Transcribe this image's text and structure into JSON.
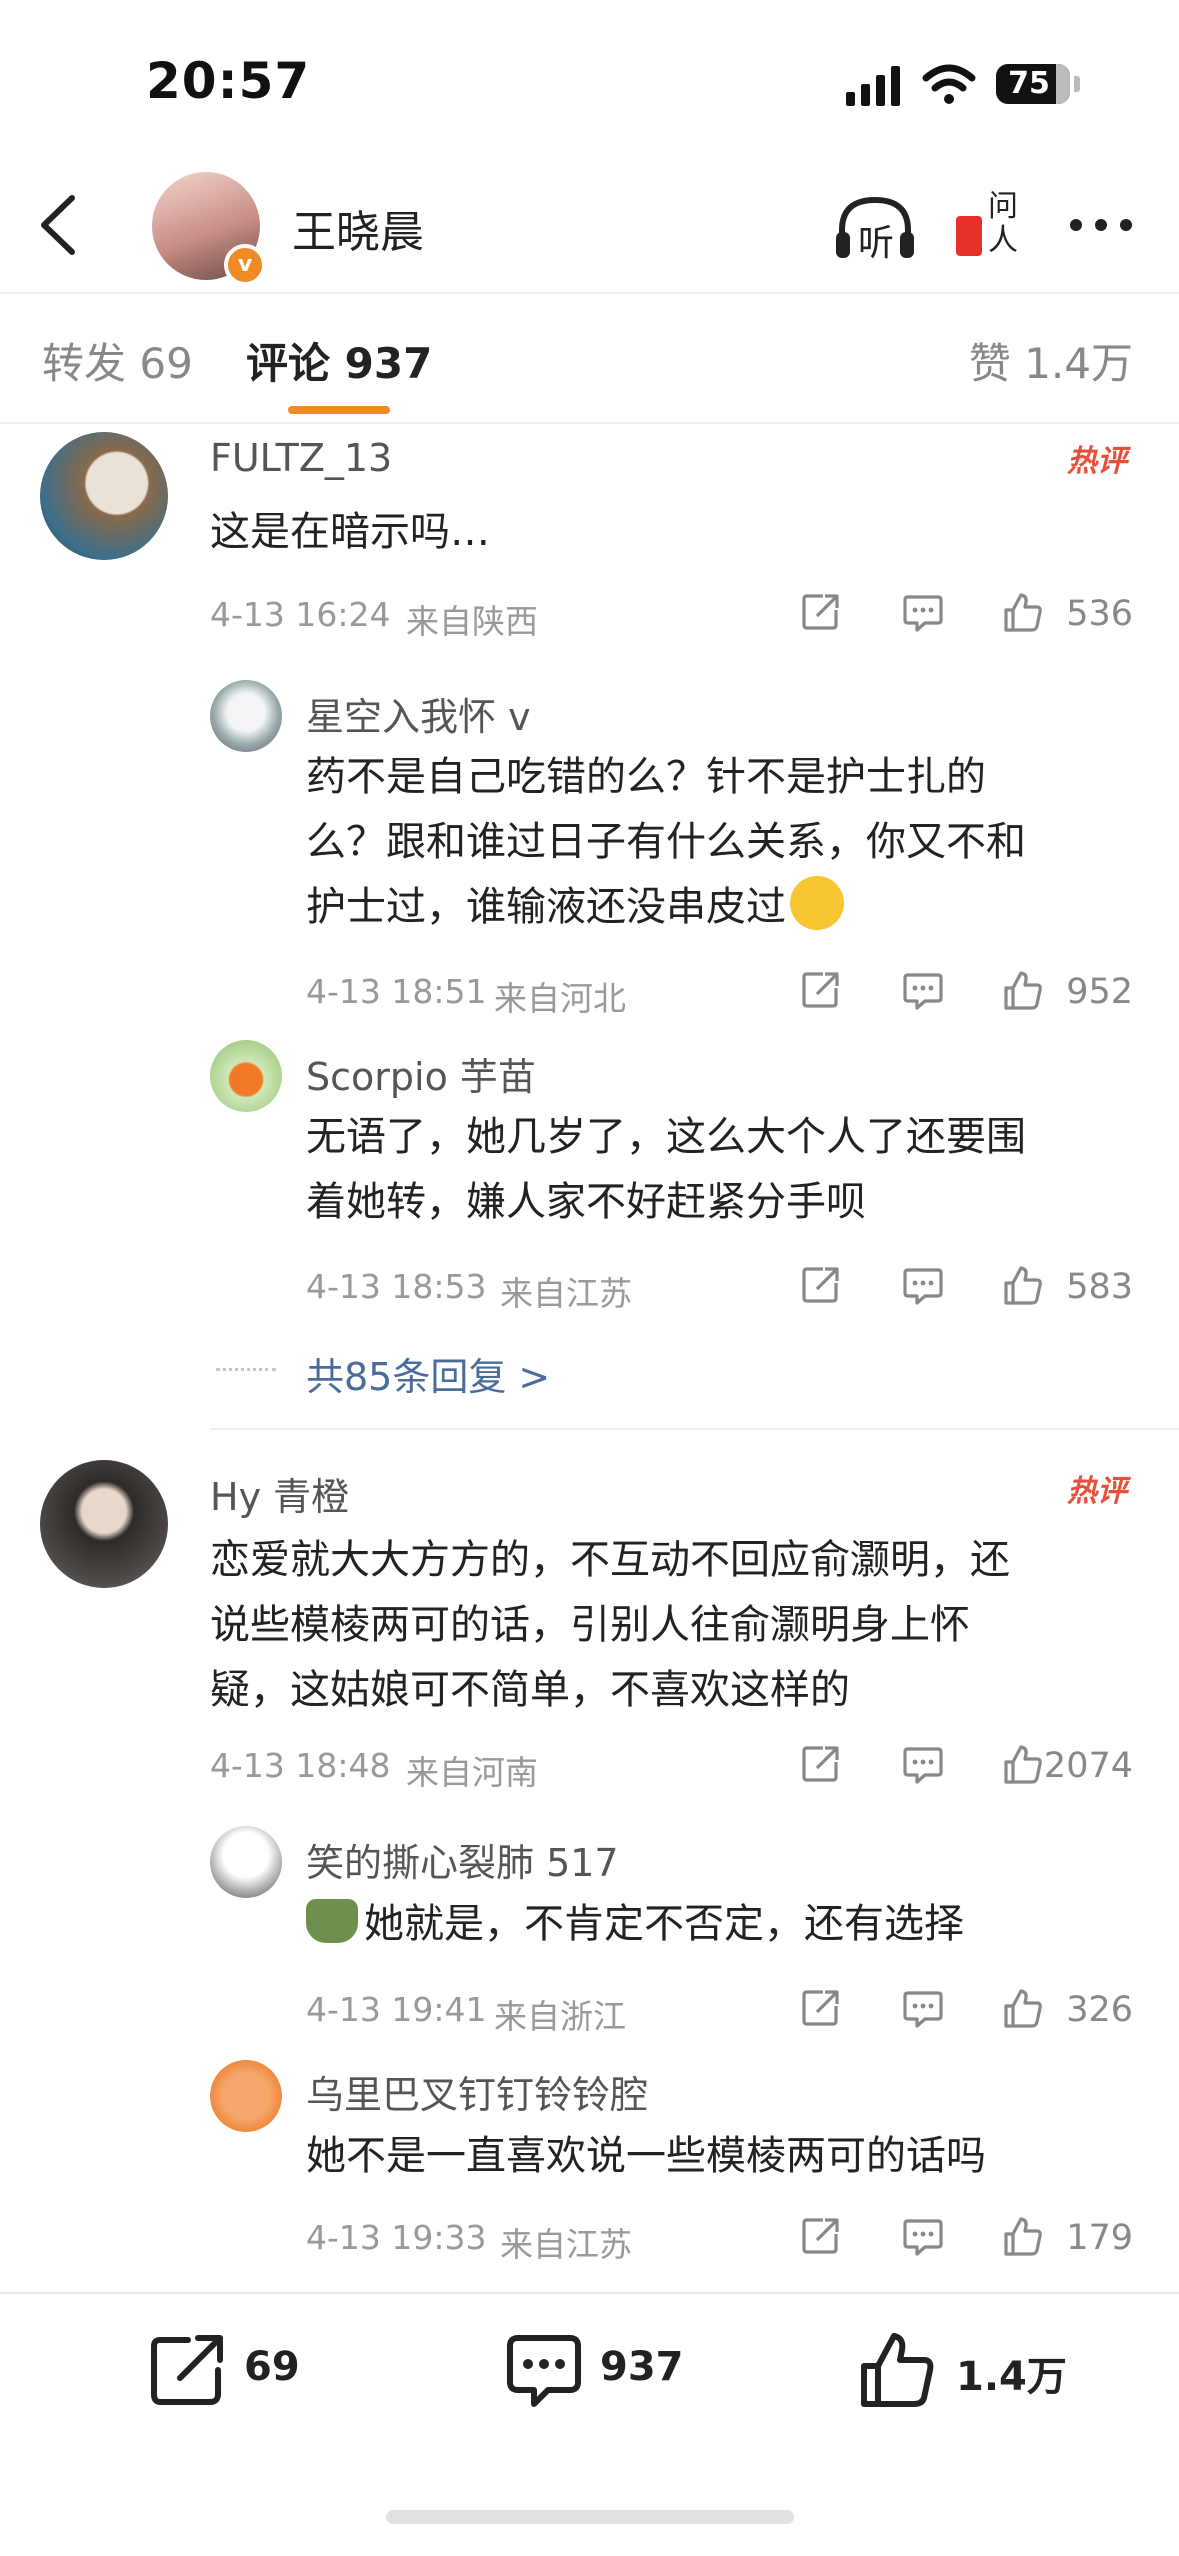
{
  "status": {
    "time": "20:57",
    "battery": "75"
  },
  "header": {
    "title": "王晓晨",
    "listen_label": "听",
    "ask_label": "问人"
  },
  "tabs": {
    "repost": "转发 69",
    "comment": "评论 937",
    "likes": "赞 1.4万"
  },
  "comments": [
    {
      "user": "FULTZ_13",
      "hot": "热评",
      "text": "这是在暗示吗…",
      "time": "4-13 16:24",
      "location": "来自陕西",
      "likes": "536",
      "replies": [
        {
          "user": "星空入我怀 v",
          "lines": [
            "药不是自己吃错的么？针不是护士扎的",
            "么？跟和谁过日子有什么关系，你又不和",
            "护士过，谁输液还没串皮过"
          ],
          "time": "4-13 18:51",
          "location": "来自河北",
          "likes": "952"
        },
        {
          "user": "Scorpio 芋苗",
          "lines": [
            "无语了，她几岁了，这么大个人了还要围",
            "着她转，嫌人家不好赶紧分手呗"
          ],
          "time": "4-13 18:53",
          "location": "来自江苏",
          "likes": "583"
        }
      ],
      "more_replies": "共85条回复 >"
    },
    {
      "user": "Hy 青橙",
      "hot": "热评",
      "lines": [
        "恋爱就大大方方的，不互动不回应俞灏明，还",
        "说些模棱两可的话，引别人往俞灏明身上怀",
        "疑，这姑娘可不简单，不喜欢这样的"
      ],
      "time": "4-13 18:48",
      "location": "来自河南",
      "likes": "2074",
      "replies": [
        {
          "user": "笑的撕心裂肺 517",
          "text": "她就是，不肯定不否定，还有选择",
          "time": "4-13 19:41",
          "location": "来自浙江",
          "likes": "326"
        },
        {
          "user": "乌里巴叉钉钉铃铃腔",
          "text": "她不是一直喜欢说一些模棱两可的话吗",
          "time": "4-13 19:33",
          "location": "来自江苏",
          "likes": "179"
        }
      ]
    }
  ],
  "bottom": {
    "repost": "69",
    "comment": "937",
    "like": "1.4万"
  },
  "colors": {
    "accent": "#f08a24",
    "hot": "#e8503a",
    "link": "#4a6c9c"
  }
}
